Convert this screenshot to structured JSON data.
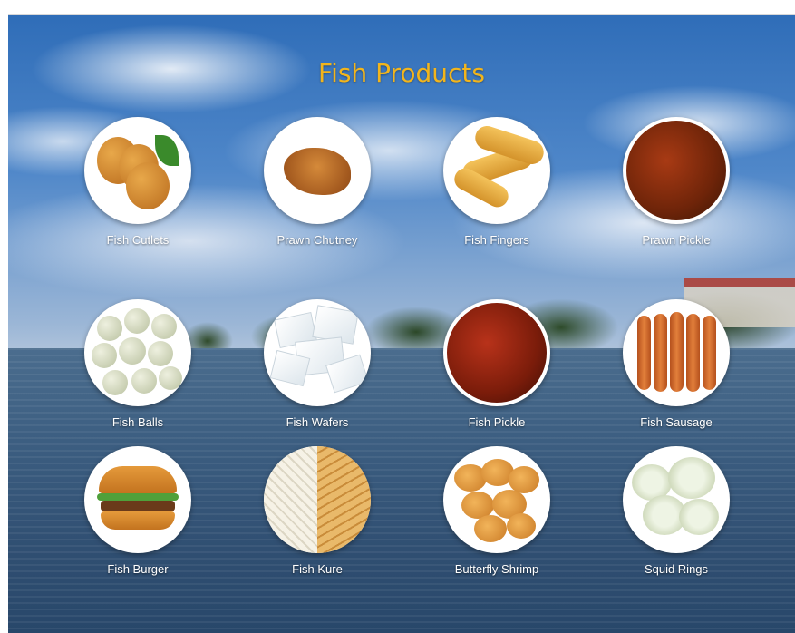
{
  "page": {
    "title": "Fish Products"
  },
  "products": [
    {
      "label": "Fish Cutlets",
      "icon": "fish-cutlets-image"
    },
    {
      "label": "Prawn Chutney",
      "icon": "prawn-chutney-image"
    },
    {
      "label": "Fish Fingers",
      "icon": "fish-fingers-image"
    },
    {
      "label": "Prawn Pickle",
      "icon": "prawn-pickle-image"
    },
    {
      "label": "Fish Balls",
      "icon": "fish-balls-image"
    },
    {
      "label": "Fish Wafers",
      "icon": "fish-wafers-image"
    },
    {
      "label": "Fish Pickle",
      "icon": "fish-pickle-image"
    },
    {
      "label": "Fish Sausage",
      "icon": "fish-sausage-image"
    },
    {
      "label": "Fish Burger",
      "icon": "fish-burger-image"
    },
    {
      "label": "Fish Kure",
      "icon": "fish-kure-image"
    },
    {
      "label": "Butterfly Shrimp",
      "icon": "butterfly-shrimp-image"
    },
    {
      "label": "Squid Rings",
      "icon": "squid-rings-image"
    }
  ],
  "colors": {
    "title": "#f2b51c",
    "label": "#ffffff",
    "circle": "#ffffff"
  }
}
